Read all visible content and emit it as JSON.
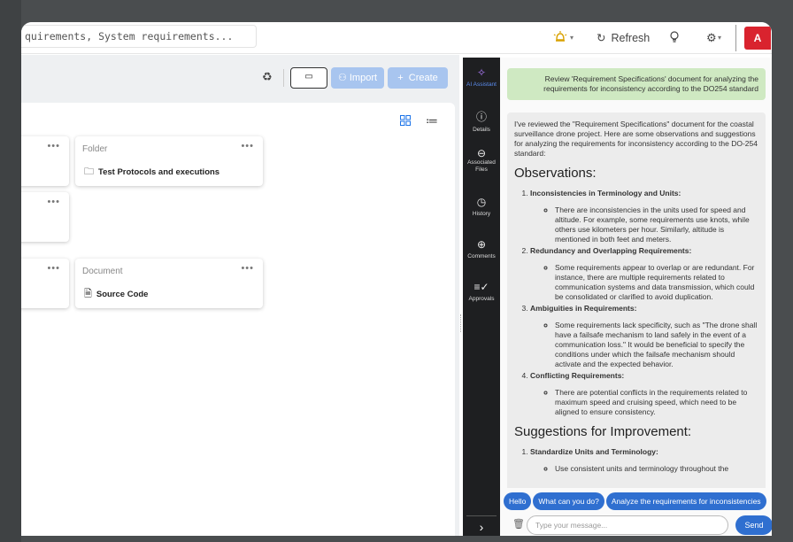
{
  "topbar": {
    "search_text": "quirements, System requirements...",
    "bell_icon": "bell-icon",
    "refresh_label": "Refresh",
    "bulb_icon": "lightbulb-icon",
    "gear_icon": "gear-icon",
    "avatar_letter": "A"
  },
  "toolbar": {
    "folder_button_icon": "folder-icon",
    "import_label": "Import",
    "create_label": "Create"
  },
  "cards": [
    {
      "kind": "",
      "name": "",
      "icon": "folder-icon"
    },
    {
      "kind": "Folder",
      "name": "Test Protocols and executions",
      "icon": "folder-icon"
    },
    {
      "kind": "",
      "name": "",
      "icon": "folder-icon"
    },
    {
      "kind": "",
      "name": "",
      "icon": "document-icon"
    },
    {
      "kind": "Document",
      "name": "Source Code",
      "icon": "document-icon"
    }
  ],
  "card_menu": "•••",
  "rail": {
    "items": [
      {
        "label": "AI Assistant",
        "icon": "sparkle-icon"
      },
      {
        "label": "Details",
        "icon": "info-icon"
      },
      {
        "label": "Associated Files",
        "icon": "attachment-icon"
      },
      {
        "label": "History",
        "icon": "clock-icon"
      },
      {
        "label": "Comments",
        "icon": "add-comment-icon"
      },
      {
        "label": "Approvals",
        "icon": "approvals-icon"
      }
    ],
    "collapse_icon": "chevron-right-icon"
  },
  "chat": {
    "user_message": "Review 'Requirement Specifications' document for analyzing the requirements for inconsistency according to the DO254 standard",
    "ai_intro": "I've reviewed the \"Requirement Specifications\" document for the coastal surveillance drone project. Here are some observations and suggestions for analyzing the requirements for inconsistency according to the DO-254 standard:",
    "observations_heading": "Observations:",
    "observations": [
      {
        "title": "Inconsistencies in Terminology and Units:",
        "detail": "There are inconsistencies in the units used for speed and altitude. For example, some requirements use knots, while others use kilometers per hour. Similarly, altitude is mentioned in both feet and meters."
      },
      {
        "title": "Redundancy and Overlapping Requirements:",
        "detail": "Some requirements appear to overlap or are redundant. For instance, there are multiple requirements related to communication systems and data transmission, which could be consolidated or clarified to avoid duplication."
      },
      {
        "title": "Ambiguities in Requirements:",
        "detail": "Some requirements lack specificity, such as \"The drone shall have a failsafe mechanism to land safely in the event of a communication loss.\" It would be beneficial to specify the conditions under which the failsafe mechanism should activate and the expected behavior."
      },
      {
        "title": "Conflicting Requirements:",
        "detail": "There are potential conflicts in the requirements related to maximum speed and cruising speed, which need to be aligned to ensure consistency."
      }
    ],
    "suggestions_heading": "Suggestions for Improvement:",
    "suggestions": [
      {
        "title": "Standardize Units and Terminology:",
        "detail": "Use consistent units and terminology throughout the"
      }
    ],
    "chips": [
      "Hello",
      "What can you do?",
      "Analyze the requirements for inconsistencies"
    ],
    "input_placeholder": "Type your message...",
    "send_label": "Send"
  }
}
